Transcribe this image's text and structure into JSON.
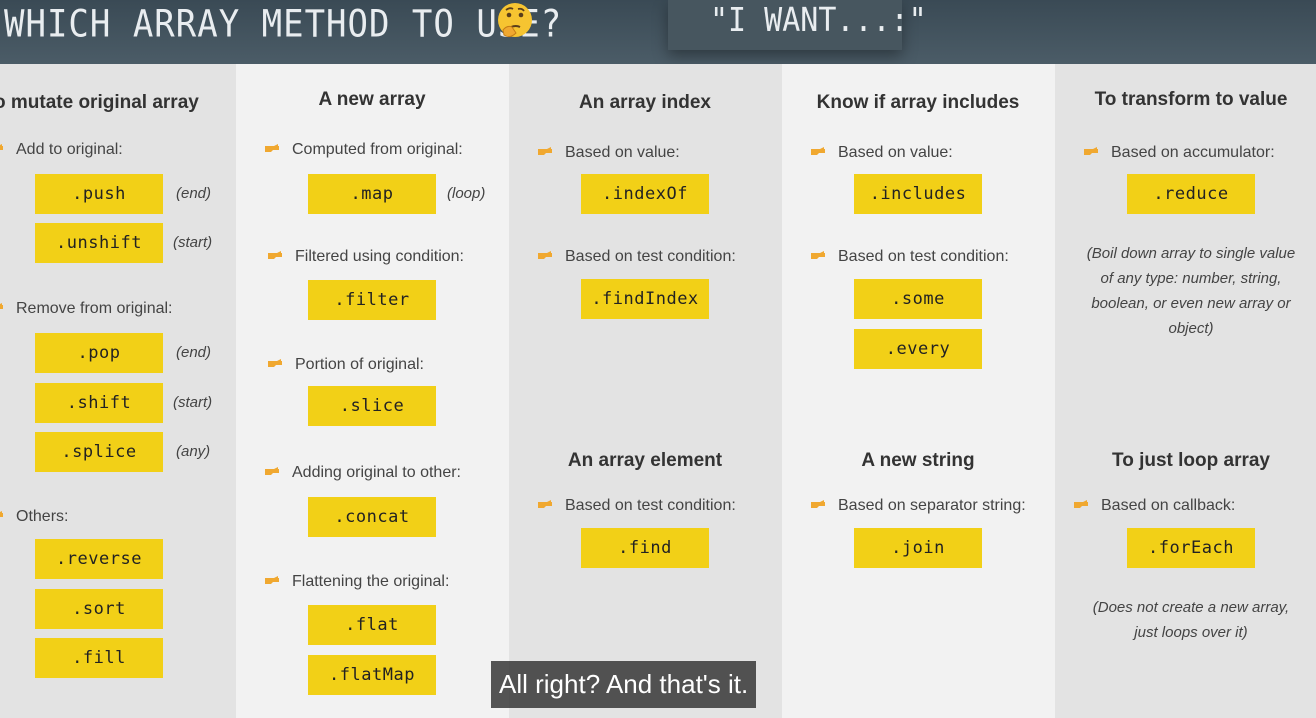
{
  "header": {
    "title": "WHICH ARRAY METHOD TO USE?",
    "emoji_icon": "thinking-face-icon",
    "want": "\"I WANT...:\""
  },
  "colors": {
    "method_bg": "#f2d017",
    "header_bg": "#3f4f5a",
    "hand_icon": "#f0a830"
  },
  "columns": {
    "mutate": {
      "heading": "o mutate original array",
      "add": "Add to original:",
      "push": ".push",
      "push_note": "(end)",
      "unshift": ".unshift",
      "unshift_note": "(start)",
      "remove": "Remove from original:",
      "pop": ".pop",
      "pop_note": "(end)",
      "shift": ".shift",
      "shift_note": "(start)",
      "splice": ".splice",
      "splice_note": "(any)",
      "others": "Others:",
      "reverse": ".reverse",
      "sort": ".sort",
      "fill": ".fill"
    },
    "new_array": {
      "heading": "A new array",
      "computed": "Computed from original:",
      "map": ".map",
      "map_note": "(loop)",
      "filtered": "Filtered using condition:",
      "filter": ".filter",
      "portion": "Portion of original:",
      "slice": ".slice",
      "adding": "Adding original to other:",
      "concat": ".concat",
      "flattening": "Flattening the original:",
      "flat": ".flat",
      "flatmap": ".flatMap"
    },
    "index": {
      "heading": "An array index",
      "value": "Based on value:",
      "indexof": ".indexOf",
      "test": "Based on test condition:",
      "findindex": ".findIndex"
    },
    "element": {
      "heading": "An array element",
      "test": "Based on test condition:",
      "find": ".find"
    },
    "includes": {
      "heading": "Know if array includes",
      "value": "Based on value:",
      "includes": ".includes",
      "test": "Based on test condition:",
      "some": ".some",
      "every": ".every"
    },
    "string": {
      "heading": "A new string",
      "separator": "Based on separator string:",
      "join": ".join"
    },
    "transform": {
      "heading": "To transform to value",
      "accumulator": "Based on accumulator:",
      "reduce": ".reduce",
      "desc": "(Boil down array to single value of any type: number, string, boolean, or even new array or object)"
    },
    "loop": {
      "heading": "To just loop array",
      "callback": "Based on callback:",
      "foreach": ".forEach",
      "desc": "(Does not create a new array, just loops over it)"
    }
  },
  "subtitle": "All right? And that's it."
}
